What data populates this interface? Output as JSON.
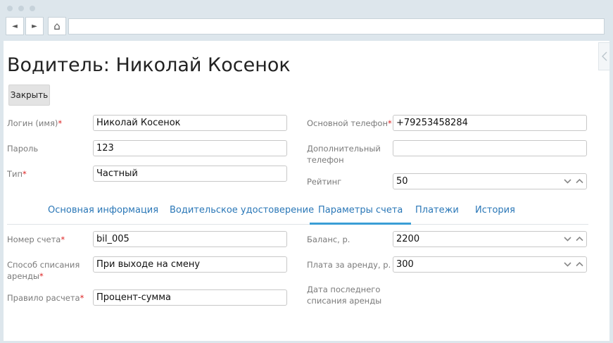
{
  "browser": {
    "back_glyph": "◄",
    "forward_glyph": "►",
    "home_glyph": "⌂"
  },
  "page_title": "Водитель: Николай Косенок",
  "buttons": {
    "close": "Закрыть"
  },
  "form_top": {
    "login_label": "Логин (имя)",
    "login_value": "Николай Косенок",
    "password_label": "Пароль",
    "password_value": "123",
    "type_label": "Тип",
    "type_value": "Частный",
    "main_phone_label": "Основной телефон",
    "main_phone_value": "+79253458284",
    "extra_phone_label_1": "Дополнительный",
    "extra_phone_label_2": "телефон",
    "extra_phone_value": "",
    "rating_label": "Рейтинг",
    "rating_value": "50"
  },
  "tabs": [
    {
      "label": "Основная информация",
      "active": false
    },
    {
      "label": "Водительское удостоверение",
      "active": false
    },
    {
      "label": "Параметры счета",
      "active": true
    },
    {
      "label": "Платежи",
      "active": false
    },
    {
      "label": "История",
      "active": false
    }
  ],
  "form_account": {
    "account_number_label": "Номер счета",
    "account_number_value": "bil_005",
    "charge_method_label_1": "Способ списания",
    "charge_method_label_2": "аренды",
    "charge_method_value": "При выходе на смену",
    "calc_rule_label": "Правило расчета",
    "calc_rule_value": "Процент-сумма",
    "balance_label": "Баланс, р.",
    "balance_value": "2200",
    "rent_fee_label": "Плата за аренду, р.",
    "rent_fee_value": "300",
    "last_charge_label_1": "Дата последнего",
    "last_charge_label_2": "списания аренды"
  },
  "required_mark": "*",
  "colors": {
    "accent": "#3a9ed6",
    "link": "#2a77b7",
    "required": "#dd2222"
  }
}
